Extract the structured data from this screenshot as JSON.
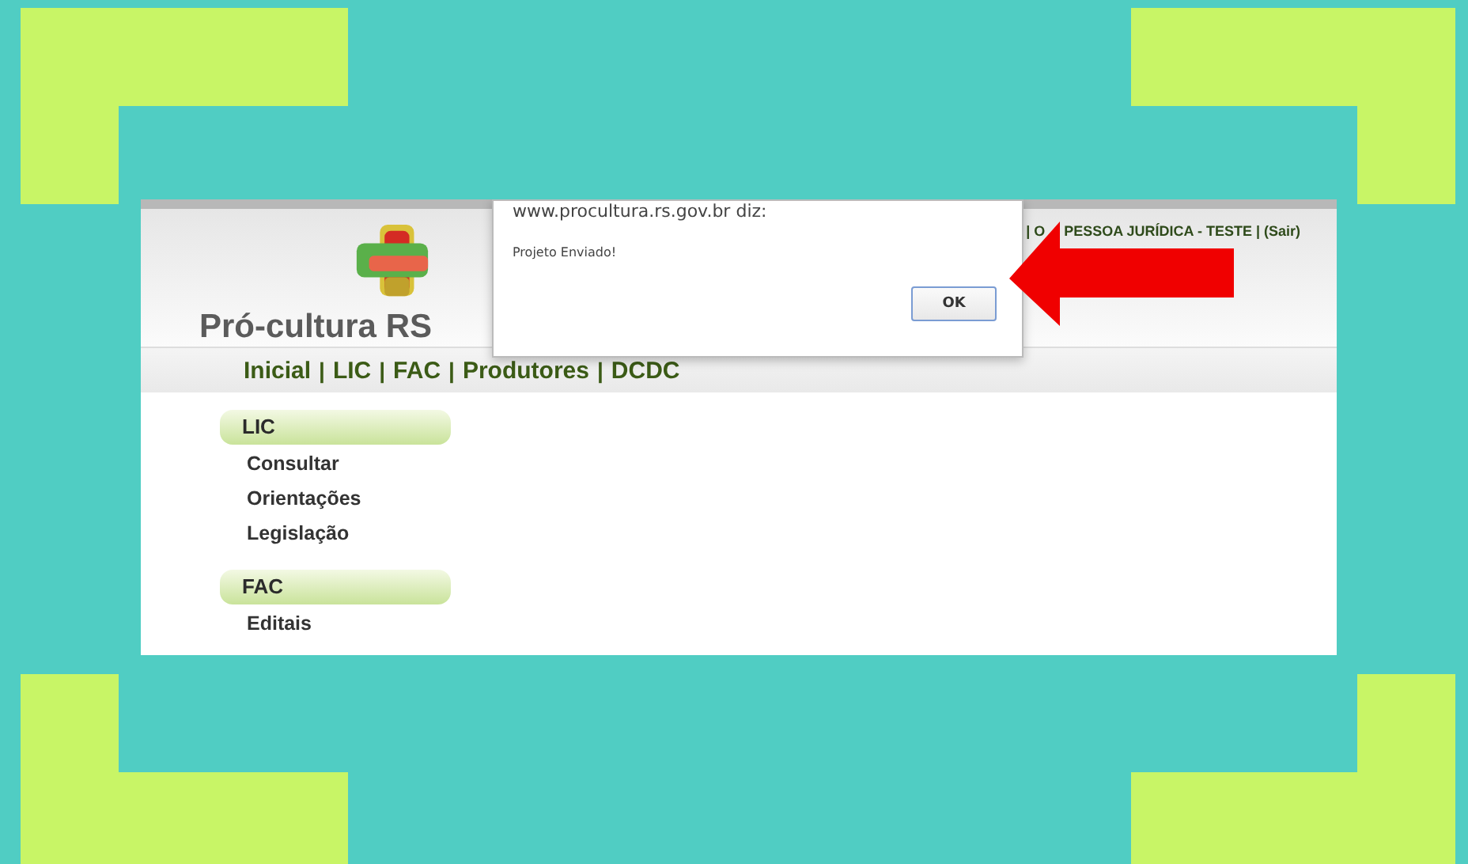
{
  "header": {
    "logo_text": "Pró-cultura RS",
    "user_info_start": "| O",
    "user_info_end": "PESSOA JURÍDICA - TESTE | (Sair)"
  },
  "nav": {
    "separator": "|",
    "items": [
      "Inicial",
      "LIC",
      "FAC",
      "Produtores",
      "DCDC"
    ]
  },
  "sidebar": {
    "sections": [
      {
        "title": "LIC",
        "items": [
          "Consultar",
          "Orientações",
          "Legislação"
        ]
      },
      {
        "title": "FAC",
        "items": [
          "Editais"
        ]
      }
    ]
  },
  "dialog": {
    "title": "www.procultura.rs.gov.br diz:",
    "message": "Projeto Enviado!",
    "button": "OK"
  }
}
